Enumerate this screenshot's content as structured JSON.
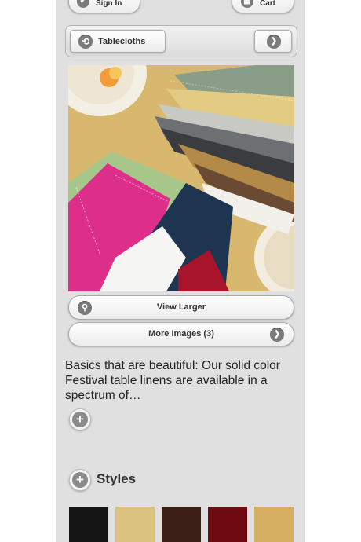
{
  "header": {
    "sign_in_label": "Sign In",
    "sign_in_icon": "checkmark-icon",
    "cart_label": "Cart",
    "cart_icon": "grid-icon"
  },
  "breadcrumb": {
    "back_icon": "back-arrow-icon",
    "label": "Tablecloths",
    "next_icon": "chevron-right-icon"
  },
  "product_image": {
    "subject": "stack of folded solid color hemstitched napkins"
  },
  "actions": {
    "view_larger_label": "View Larger",
    "view_larger_icon": "magnifier-icon",
    "more_images_label": "More Images (3)",
    "more_images_icon": "chevron-right-icon"
  },
  "description": {
    "text": "Basics that are beautiful: Our solid color Festival table linens are available in a spectrum of…",
    "expand_icon": "plus-icon"
  },
  "styles": {
    "heading": "Styles",
    "expand_icon": "plus-icon",
    "swatches": [
      {
        "color": "#151515"
      },
      {
        "color": "#dcc27f"
      },
      {
        "color": "#3b1f17"
      },
      {
        "color": "#6e0b10"
      },
      {
        "color": "#d6ae62"
      }
    ]
  }
}
